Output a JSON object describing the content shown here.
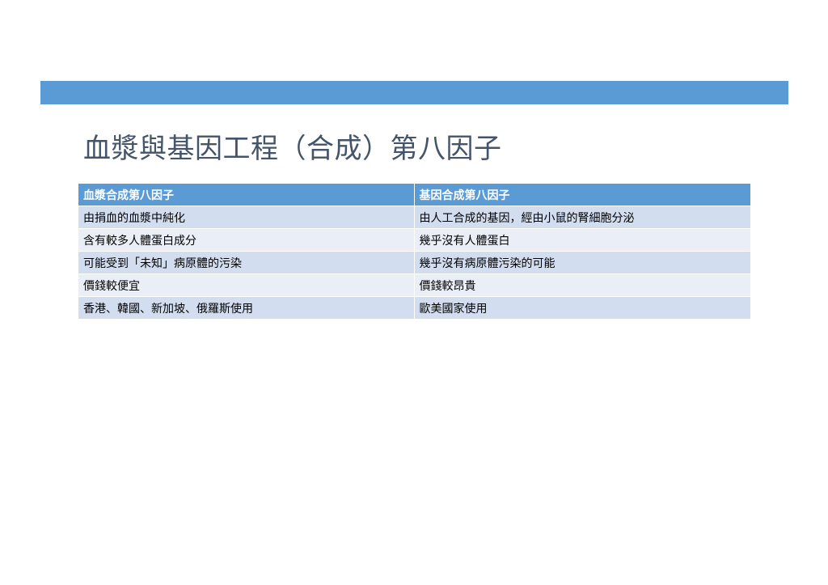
{
  "slide": {
    "title": "血漿與基因工程（合成）第八因子",
    "accent_color": "#5b9bd5"
  },
  "table": {
    "headers": [
      "血漿合成第八因子",
      "基因合成第八因子"
    ],
    "rows": [
      [
        "由捐血的血漿中純化",
        "由人工合成的基因，經由小鼠的腎細胞分泌"
      ],
      [
        "含有較多人體蛋白成分",
        "幾乎沒有人體蛋白"
      ],
      [
        "可能受到「未知」病原體的污染",
        "幾乎沒有病原體污染的可能"
      ],
      [
        "價錢較便宜",
        "價錢較昂貴"
      ],
      [
        "香港、韓國、新加坡、俄羅斯使用",
        "歐美國家使用"
      ]
    ]
  }
}
